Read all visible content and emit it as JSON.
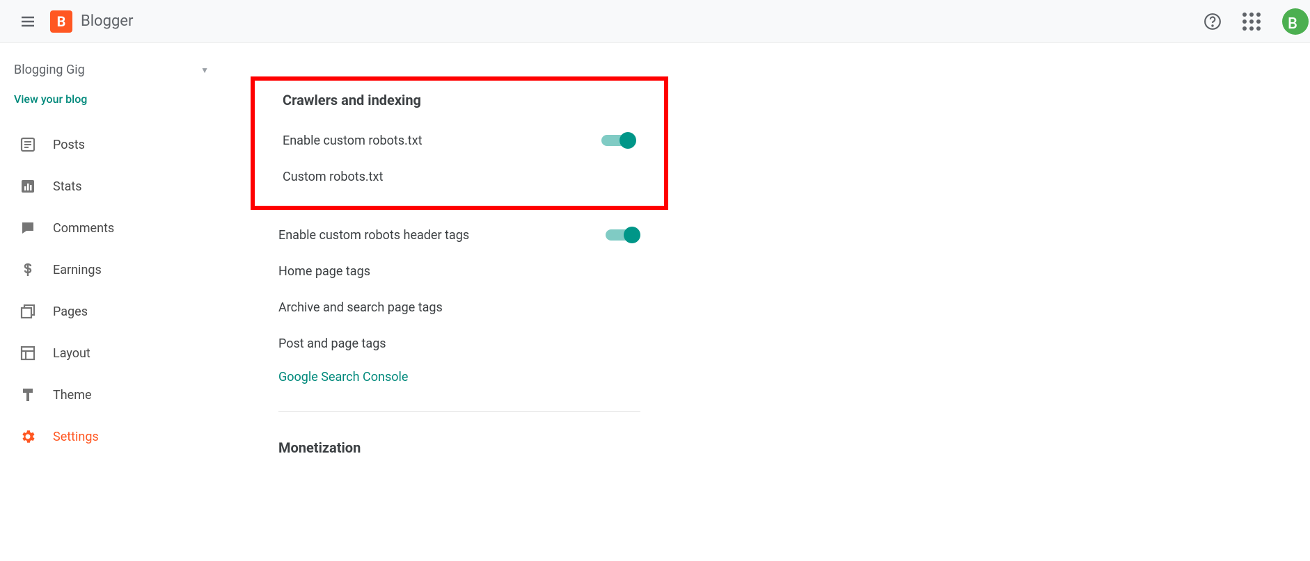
{
  "header": {
    "product_name": "Blogger",
    "logo_letter": "B",
    "avatar_letter": "B"
  },
  "sidebar": {
    "blog_name": "Blogging Gig",
    "view_link": "View your blog",
    "items": [
      {
        "label": "Posts",
        "icon": "posts-icon"
      },
      {
        "label": "Stats",
        "icon": "stats-icon"
      },
      {
        "label": "Comments",
        "icon": "comments-icon"
      },
      {
        "label": "Earnings",
        "icon": "earnings-icon"
      },
      {
        "label": "Pages",
        "icon": "pages-icon"
      },
      {
        "label": "Layout",
        "icon": "layout-icon"
      },
      {
        "label": "Theme",
        "icon": "theme-icon"
      },
      {
        "label": "Settings",
        "icon": "settings-icon"
      }
    ],
    "active_index": 7
  },
  "main": {
    "sections": {
      "crawlers": {
        "title": "Crawlers and indexing",
        "enable_custom_robots": "Enable custom robots.txt",
        "custom_robots": "Custom robots.txt",
        "enable_header_tags": "Enable custom robots header tags",
        "home_page_tags": "Home page tags",
        "archive_tags": "Archive and search page tags",
        "post_tags": "Post and page tags",
        "search_console": "Google Search Console"
      },
      "monetization": {
        "title": "Monetization"
      }
    },
    "toggles": {
      "custom_robots": true,
      "header_tags": true
    }
  }
}
